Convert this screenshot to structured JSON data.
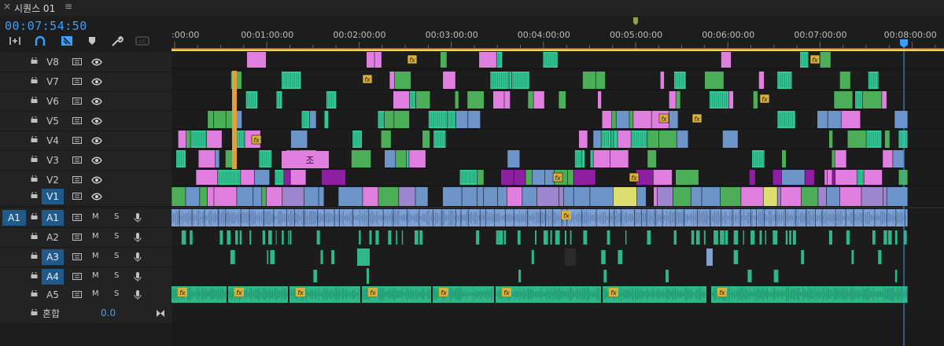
{
  "tab": {
    "close": "×",
    "title": "시퀀스 01",
    "menu": "≡"
  },
  "timecode": "00:07:54:50",
  "tools": [
    "insert-icon",
    "snap-magnet-icon",
    "linked-selection-icon",
    "marker-icon",
    "wrench-icon",
    "captions-icon"
  ],
  "ruler": {
    "labels": [
      ":00:00",
      "00:01:00:00",
      "00:02:00:00",
      "00:03:00:00",
      "00:04:00:00",
      "00:05:00:00",
      "00:06:00:00",
      "00:07:00:00",
      "00:08:00:00"
    ]
  },
  "sequence": {
    "duration_min": 8.0,
    "playhead_min": 7.91,
    "marker_min": 5.0
  },
  "video_tracks": [
    {
      "name": "V8"
    },
    {
      "name": "V7"
    },
    {
      "name": "V6"
    },
    {
      "name": "V5"
    },
    {
      "name": "V4"
    },
    {
      "name": "V3"
    },
    {
      "name": "V2"
    },
    {
      "name": "V1",
      "selected": true
    }
  ],
  "audio_tracks": [
    {
      "name": "A1",
      "selected": true,
      "source": "A1",
      "mute": "M",
      "solo": "S"
    },
    {
      "name": "A2",
      "mute": "M",
      "solo": "S"
    },
    {
      "name": "A3",
      "selected": true,
      "mute": "M",
      "solo": "S"
    },
    {
      "name": "A4",
      "selected": true,
      "mute": "M",
      "solo": "S"
    },
    {
      "name": "A5",
      "mute": "M",
      "solo": "S"
    }
  ],
  "mix": {
    "label": "혼합",
    "value": "0.0"
  },
  "clip_title_text": "조",
  "fx_label": "fx",
  "colors": {
    "accent": "#3aa0ff",
    "pink": "#e07fe0",
    "teal": "#34c896",
    "green": "#4cae58",
    "blue": "#6d95c9",
    "violet": "#9e85cf",
    "yellow": "#dede70",
    "purple": "#8e1fa3",
    "orange": "#e0a040",
    "audio_blue": "#7fa2d6",
    "audio_green": "#2fb787"
  }
}
